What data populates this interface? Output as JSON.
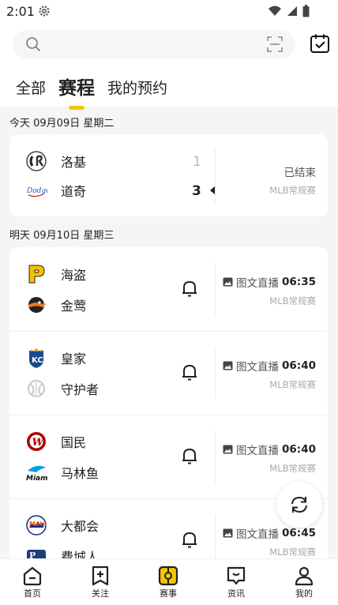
{
  "status_bar": {
    "time": "2:01",
    "icons": [
      "gear-icon",
      "wifi-icon",
      "signal-icon",
      "battery-icon"
    ]
  },
  "header": {
    "search": {
      "placeholder": ""
    },
    "tabs": [
      {
        "label": "全部",
        "active": false
      },
      {
        "label": "赛程",
        "active": true
      },
      {
        "label": "我的预约",
        "active": false
      }
    ]
  },
  "sections": [
    {
      "date_label": "今天 09月09日 星期二",
      "games": [
        {
          "home": {
            "name": "洛基",
            "logo": "rockies-logo",
            "score": "1"
          },
          "away": {
            "name": "道奇",
            "logo": "dodgers-logo",
            "score": "3"
          },
          "status": "已结束",
          "league": "MLB常规赛"
        }
      ]
    },
    {
      "date_label": "明天 09月10日 星期三",
      "games": [
        {
          "home": {
            "name": "海盗",
            "logo": "pirates-logo"
          },
          "away": {
            "name": "金莺",
            "logo": "orioles-logo"
          },
          "status": "图文直播",
          "time": "06:35",
          "league": "MLB常规赛"
        },
        {
          "home": {
            "name": "皇家",
            "logo": "royals-logo"
          },
          "away": {
            "name": "守护者",
            "logo": "guardians-logo"
          },
          "status": "图文直播",
          "time": "06:40",
          "league": "MLB常规赛"
        },
        {
          "home": {
            "name": "国民",
            "logo": "nationals-logo"
          },
          "away": {
            "name": "马林鱼",
            "logo": "marlins-logo"
          },
          "status": "图文直播",
          "time": "06:40",
          "league": "MLB常规赛"
        },
        {
          "home": {
            "name": "大都会",
            "logo": "mets-logo"
          },
          "away": {
            "name": "费城人",
            "logo": "phillies-logo"
          },
          "status": "图文直播",
          "time": "06:45",
          "league": "MLB常规赛"
        }
      ]
    }
  ],
  "bottom_nav": [
    {
      "label": "首页",
      "icon": "home-icon"
    },
    {
      "label": "关注",
      "icon": "follow-icon"
    },
    {
      "label": "赛事",
      "icon": "events-icon",
      "active": true
    },
    {
      "label": "资讯",
      "icon": "news-icon"
    },
    {
      "label": "我的",
      "icon": "profile-icon"
    }
  ],
  "colors": {
    "accent": "#f7c400",
    "background": "#f5f5f5",
    "card": "#ffffff"
  }
}
